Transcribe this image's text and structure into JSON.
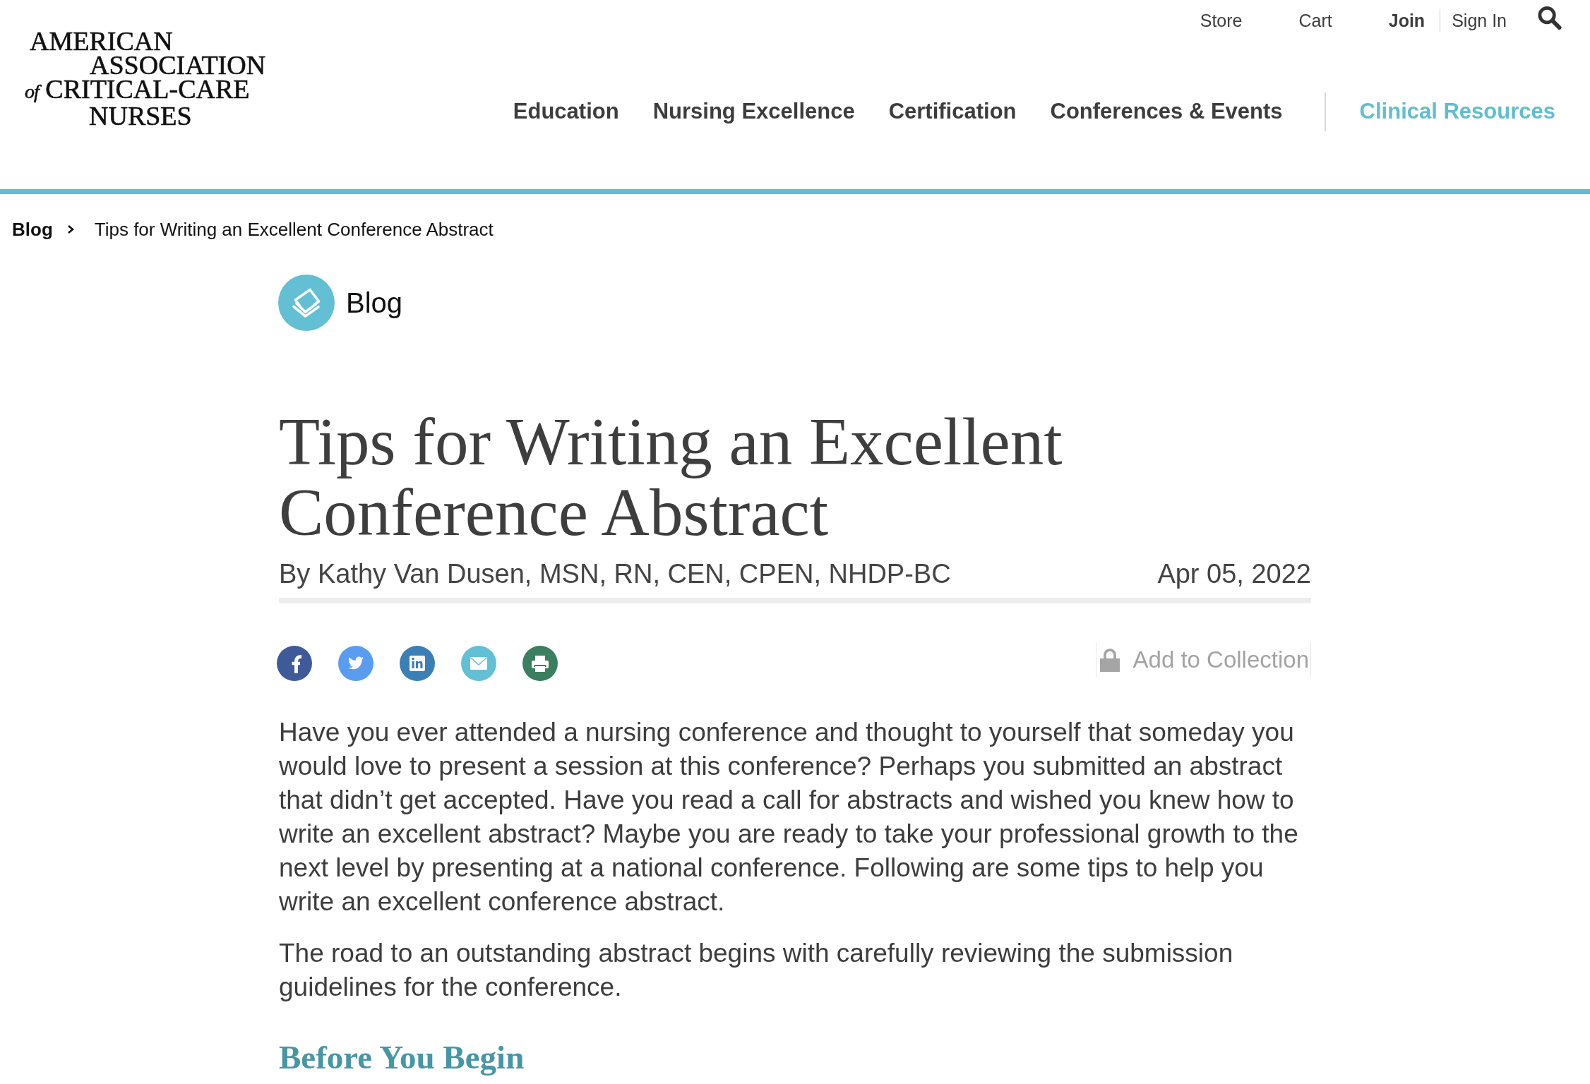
{
  "header": {
    "logo": {
      "lines": [
        {
          "text": "AMERICAN"
        },
        {
          "text": "ASSOCIATION"
        },
        {
          "prefix": "of",
          "text": "CRITICAL-CARE"
        },
        {
          "text": "NURSES"
        }
      ]
    },
    "utility_links": [
      {
        "label": "Store",
        "emphasized": false
      },
      {
        "label": "Cart",
        "emphasized": false
      },
      {
        "label": "Join",
        "emphasized": true
      },
      {
        "label": "Sign In",
        "emphasized": false
      }
    ],
    "main_nav": [
      {
        "label": "Education",
        "selected": false
      },
      {
        "label": "Nursing Excellence",
        "selected": false
      },
      {
        "label": "Certification",
        "selected": false
      },
      {
        "label": "Conferences & Events",
        "selected": false
      },
      {
        "label": "Clinical Resources",
        "selected": true
      }
    ]
  },
  "breadcrumb": [
    {
      "label": "Blog",
      "current": false
    },
    {
      "label": "Tips for Writing an Excellent Conference Abstract",
      "current": true
    }
  ],
  "section": {
    "label": "Blog"
  },
  "article": {
    "title": "Tips for Writing an Excellent Conference Abstract",
    "byline": "By Kathy Van Dusen, MSN, RN, CEN, CPEN, NHDP-BC",
    "date": "Apr 05, 2022",
    "share_buttons": [
      {
        "kind": "facebook",
        "color": "#3f5a99"
      },
      {
        "kind": "twitter",
        "color": "#5a9cf0"
      },
      {
        "kind": "linkedin",
        "color": "#3b7fb6"
      },
      {
        "kind": "email",
        "color": "#63c0d4"
      },
      {
        "kind": "print",
        "color": "#3a7f5f"
      }
    ],
    "collection_button": {
      "label": "Add to Collection"
    },
    "body": [
      {
        "kind": "paragraph",
        "text": "Have you ever attended a nursing conference and thought to yourself that someday you would love to present a session at this conference? Perhaps you submitted an abstract that didn’t get accepted. Have you read a call for abstracts and wished you knew how to write an excellent abstract? Maybe you are ready to take your professional growth to the next level by presenting at a national conference. Following are some tips to help you write an excellent conference abstract."
      },
      {
        "kind": "paragraph",
        "text": "The road to an outstanding abstract begins with carefully reviewing the submission guidelines for the conference."
      },
      {
        "kind": "heading",
        "text": "Before You Begin"
      }
    ]
  }
}
